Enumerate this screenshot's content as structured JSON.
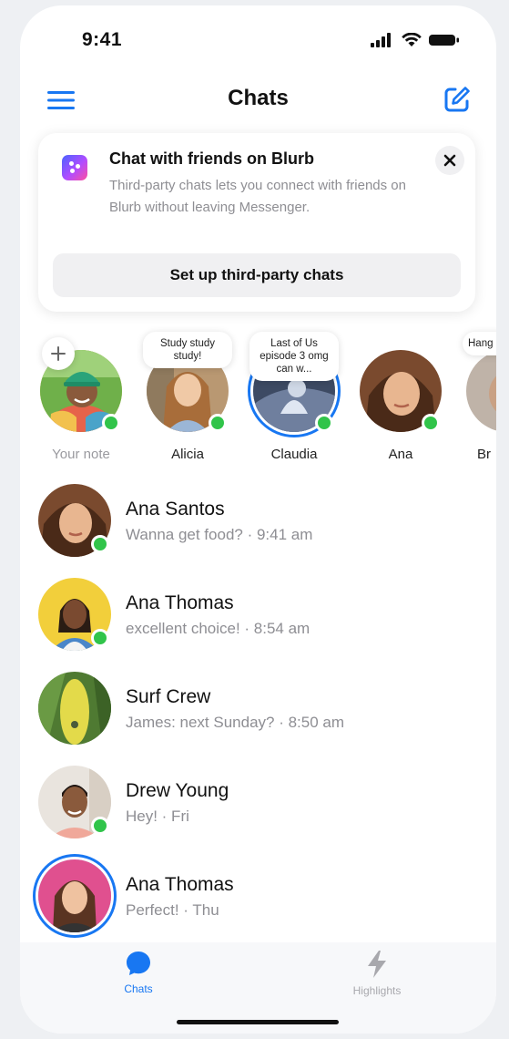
{
  "status_bar": {
    "time": "9:41"
  },
  "header": {
    "title": "Chats"
  },
  "promo": {
    "title": "Chat with friends on Blurb",
    "body": "Third-party chats lets you connect with friends on Blurb without leaving Messenger.",
    "button_label": "Set up third-party chats"
  },
  "notes": [
    {
      "name": "Your note",
      "note": "",
      "online": true
    },
    {
      "name": "Alicia",
      "note": "Study study study!",
      "online": true
    },
    {
      "name": "Claudia",
      "note": "Last of Us episode 3 omg can w...",
      "online": true
    },
    {
      "name": "Ana",
      "note": "",
      "online": true
    },
    {
      "name": "Br",
      "note": "Hang",
      "online": false
    }
  ],
  "chats": [
    {
      "name": "Ana Santos",
      "preview": "Wanna get food? · 9:41 am",
      "online": true
    },
    {
      "name": "Ana Thomas",
      "preview": "excellent choice! · 8:54 am",
      "online": true
    },
    {
      "name": "Surf Crew",
      "preview": "James: next Sunday? · 8:50 am",
      "online": false
    },
    {
      "name": "Drew Young",
      "preview": "Hey! · Fri",
      "online": true
    },
    {
      "name": "Ana Thomas",
      "preview": "Perfect! · Thu",
      "online": false
    }
  ],
  "tabs": [
    {
      "label": "Chats",
      "icon": "chat-bubble-icon",
      "active": true
    },
    {
      "label": "Highlights",
      "icon": "lightning-icon",
      "active": false
    }
  ],
  "colors": {
    "accent": "#1877f2",
    "online": "#31c44a",
    "muted_text": "#8e8e93"
  }
}
